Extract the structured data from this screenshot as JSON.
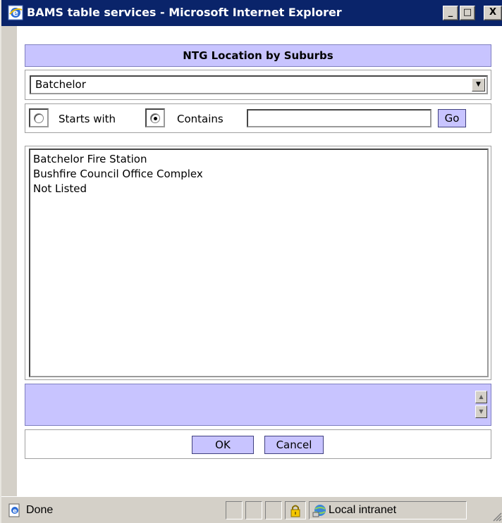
{
  "window": {
    "title": "BAMS table services - Microsoft Internet Explorer",
    "min_label": "_",
    "max_label": "□",
    "close_label": "X"
  },
  "dialog": {
    "heading": "NTG Location by Suburbs",
    "suburb_select": {
      "selected": "Batchelor"
    },
    "search": {
      "starts_with_label": "Starts with",
      "contains_label": "Contains",
      "mode_selected": "Contains",
      "value": "",
      "go_label": "Go"
    },
    "results": [
      "Batchelor Fire Station",
      "Bushfire Council Office Complex",
      "Not Listed"
    ],
    "description": "",
    "ok_label": "OK",
    "cancel_label": "Cancel"
  },
  "status": {
    "text": "Done",
    "zone": "Local intranet"
  },
  "icons": {
    "ie": "internet-explorer-icon",
    "page": "page-done-icon",
    "lock": "lock-icon",
    "zone": "intranet-globe-icon"
  },
  "colors": {
    "title_bar": "#0a246a",
    "accent_lavender": "#c8c4ff",
    "chrome": "#d4d0c8"
  }
}
